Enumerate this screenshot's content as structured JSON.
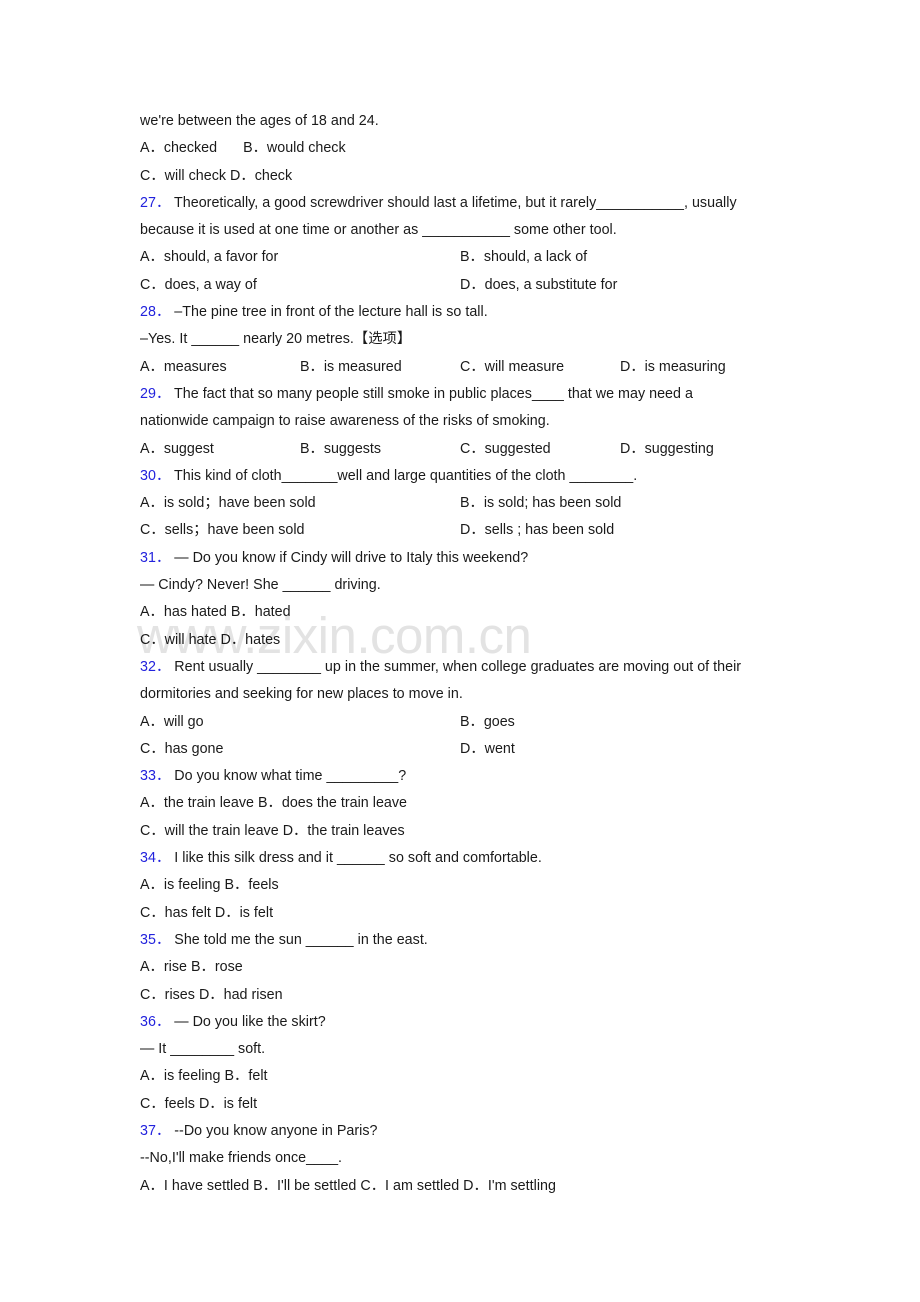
{
  "document": {
    "type": "english-grammar-worksheet",
    "watermark": "www.zixin.com.cn",
    "watermark_color": "#e3e3e3",
    "question_number_color": "#2222dd",
    "text_color": "#1a1a1a",
    "background_color": "#ffffff"
  },
  "lines": {
    "carryover_stem": "we're between the ages of 18 and 24.",
    "carryover_opt_ac": "A．checked",
    "carryover_opt_bd": "B．would check",
    "carryover_opt_c": "C．will check   D．check"
  },
  "questions": [
    {
      "number": "27．",
      "stem_line1": "Theoretically, a good screwdriver should last a lifetime, but it rarely___________, usually",
      "stem_line2": "because it is used at one time or another as ___________ some other tool.",
      "layout": "two-column",
      "options": {
        "a": "A．should, a favor for",
        "b": "B．should, a lack of",
        "c": "C．does, a way of",
        "d": "D．does, a substitute for"
      }
    },
    {
      "number": "28．",
      "stem_line1": "–The pine tree in front of the lecture hall is so tall.",
      "stem_line2": "–Yes. It ______ nearly 20 metres.【选项】",
      "layout": "four-column",
      "options": {
        "a": "A．measures",
        "b": "B．is measured",
        "c": "C．will measure",
        "d": "D．is measuring"
      }
    },
    {
      "number": "29．",
      "stem_line1": "The fact that so many people still smoke in public places____ that we may need a",
      "stem_line2": "nationwide campaign to raise awareness of the risks of smoking.",
      "layout": "four-column",
      "options": {
        "a": "A．suggest",
        "b": "B．suggests",
        "c": "C．suggested",
        "d": "D．suggesting"
      }
    },
    {
      "number": "30．",
      "stem_line1": "This kind of cloth_______well and large quantities of the cloth ________.",
      "stem_line2": "",
      "layout": "two-column",
      "options": {
        "a": "A．is sold；have been sold",
        "b": "B．is sold; has been sold",
        "c": "C．sells；have been sold",
        "d": "D．sells ; has been sold"
      }
    },
    {
      "number": "31．",
      "stem_line1": "— Do you know if Cindy will drive to Italy this weekend?",
      "stem_line2": "— Cindy? Never! She ______ driving.",
      "layout": "inline-pairs",
      "options": {
        "a": "A．has hated",
        "b": "B．hated",
        "c": "C．will hate",
        "d": "D．hates"
      },
      "row1": "A．has hated   B．hated",
      "row2": "C．will hate   D．hates"
    },
    {
      "number": "32．",
      "stem_line1": "Rent usually ________ up in the summer, when college graduates are moving out of their",
      "stem_line2": "dormitories and seeking for new places to move in.",
      "layout": "two-column",
      "options": {
        "a": "A．will go",
        "b": "B．goes",
        "c": "C．has gone",
        "d": "D．went"
      }
    },
    {
      "number": "33．",
      "stem_line1": "Do you know what time _________?",
      "stem_line2": "",
      "layout": "inline-pairs",
      "options": {
        "a": "A．the train leave",
        "b": "B．does the train leave",
        "c": "C．will the train leave",
        "d": "D．the train leaves"
      },
      "row1": "A．the train leave   B．does the train leave",
      "row2": "C．will the train leave   D．the train leaves"
    },
    {
      "number": "34．",
      "stem_line1": "I like this silk dress and it ______ so soft and comfortable.",
      "stem_line2": "",
      "layout": "inline-pairs",
      "options": {
        "a": "A．is feeling",
        "b": "B．feels",
        "c": "C．has felt",
        "d": "D．is felt"
      },
      "row1": "A．is feeling   B．feels",
      "row2": "C．has felt   D．is felt"
    },
    {
      "number": "35．",
      "stem_line1": "She told me the sun ______ in the east.",
      "stem_line2": "",
      "layout": "inline-pairs",
      "options": {
        "a": "A．rise",
        "b": "B．rose",
        "c": "C．rises",
        "d": "D．had risen"
      },
      "row1": "A．rise   B．rose",
      "row2": "C．rises   D．had risen"
    },
    {
      "number": "36．",
      "stem_line1": "— Do you like the skirt?",
      "stem_line2": "— It ________ soft.",
      "layout": "inline-pairs",
      "options": {
        "a": "A．is feeling",
        "b": "B．felt",
        "c": "C．feels",
        "d": "D．is felt"
      },
      "row1": "A．is feeling   B．felt",
      "row2": "C．feels   D．is felt"
    },
    {
      "number": "37．",
      "stem_line1": "--Do you know anyone in Paris?",
      "stem_line2": "--No,I'll make friends once____.",
      "layout": "single-row",
      "options": {
        "a": "A．I have settled",
        "b": "B．I'll be settled",
        "c": "C．I am settled",
        "d": "D．I'm settling"
      },
      "row1": "A．I have settled   B．I'll be settled   C．I am settled   D．I'm settling"
    }
  ]
}
